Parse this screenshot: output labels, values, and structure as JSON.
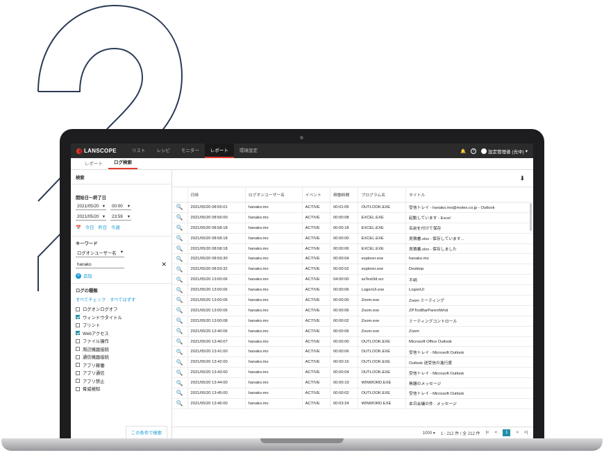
{
  "app": {
    "logo": "LANSCOPE"
  },
  "nav": {
    "items": [
      "リスト",
      "レシピ",
      "モニター",
      "レポート",
      "環境設定"
    ],
    "active_index": 3,
    "user": "設定管理者 (光中)"
  },
  "subtabs": {
    "items": [
      "レポート",
      "ログ検索"
    ],
    "active_index": 1
  },
  "filter": {
    "title": "検索",
    "date_label": "開始日〜終了日",
    "start_date": "2021/05/20",
    "start_time": "00:00",
    "end_date": "2021/05/20",
    "end_time": "23:59",
    "quick": [
      "今日",
      "昨日",
      "今週"
    ],
    "keyword_label": "キーワード",
    "keyword_field": "ログオンユーザー名",
    "keyword_value": "hanako",
    "add_label": "追加",
    "types_label": "ログの種類",
    "check_all": "すべてチェック",
    "uncheck_all": "すべてはずす",
    "types": [
      {
        "label": "ログオンログオフ",
        "checked": false
      },
      {
        "label": "ウィンドウタイトル",
        "checked": true
      },
      {
        "label": "プリント",
        "checked": false
      },
      {
        "label": "Webアクセス",
        "checked": true
      },
      {
        "label": "ファイル操作",
        "checked": false
      },
      {
        "label": "周辺機器接続",
        "checked": false
      },
      {
        "label": "通信機器接続",
        "checked": false
      },
      {
        "label": "アプリ稼働",
        "checked": false
      },
      {
        "label": "アプリ通信",
        "checked": false
      },
      {
        "label": "アプリ禁止",
        "checked": false
      },
      {
        "label": "脅威検知",
        "checked": false
      }
    ],
    "search_button": "この条件で検索"
  },
  "table": {
    "columns": [
      "日時",
      "ログオンユーザー名",
      "イベント",
      "稼働時間",
      "プログラム名",
      "タイトル"
    ],
    "rows": [
      [
        "2021/05/20 08:55:01",
        "hanako.mo",
        "ACTIVE",
        "00:01:05",
        "OUTLOOK.EXE",
        "受信トレイ - hanako.mo@motex.co.jp - Outlook"
      ],
      [
        "2021/05/20 08:56:00",
        "hanako.mo",
        "ACTIVE",
        "00:00:08",
        "EXCEL.EXE",
        "起動しています - Excel"
      ],
      [
        "2021/05/20 08:58:18",
        "hanako.mo",
        "ACTIVE",
        "00:00:18",
        "EXCEL.EXE",
        "名前を付けて保存"
      ],
      [
        "2021/05/20 08:58:18",
        "hanako.mo",
        "ACTIVE",
        "00:00:00",
        "EXCEL.EXE",
        "見積書.xlsx - 保存しています..."
      ],
      [
        "2021/05/20 08:58:18",
        "hanako.mo",
        "ACTIVE",
        "00:00:06",
        "EXCEL.EXE",
        "見積書.xlsx - 保存しました"
      ],
      [
        "2021/05/20 08:59:30",
        "hanako.mo",
        "ACTIVE",
        "00:00:04",
        "explorer.exe",
        "hanako.mo"
      ],
      [
        "2021/05/20 08:59:32",
        "hanako.mo",
        "ACTIVE",
        "00:00:02",
        "explorer.exe",
        "Desktop"
      ],
      [
        "2021/05/20 13:00:06",
        "hanako.mo",
        "ACTIVE",
        "04:00:00",
        "ssText3d.scr",
        "不明"
      ],
      [
        "2021/05/20 13:00:06",
        "hanako.mo",
        "ACTIVE",
        "00:00:06",
        "LogonUI.exe",
        "LogonUI"
      ],
      [
        "2021/05/20 13:00:06",
        "hanako.mo",
        "ACTIVE",
        "00:00:00",
        "Zoom.exe",
        "Zoom ミーティング"
      ],
      [
        "2021/05/20 13:00:06",
        "hanako.mo",
        "ACTIVE",
        "00:00:06",
        "Zoom.exe",
        "ZPToolBarParentWnd"
      ],
      [
        "2021/05/20 13:00:08",
        "hanako.mo",
        "ACTIVE",
        "00:00:02",
        "Zoom.exe",
        "ミーティングコントロール"
      ],
      [
        "2021/05/20 13:40:06",
        "hanako.mo",
        "ACTIVE",
        "00:00:06",
        "Zoom.exe",
        "Zoom"
      ],
      [
        "2021/05/20 13:40:07",
        "hanako.mo",
        "ACTIVE",
        "00:00:00",
        "OUTLOOK.EXE",
        "Microsoft Office Outlook"
      ],
      [
        "2021/05/20 13:41:00",
        "hanako.mo",
        "ACTIVE",
        "00:00:06",
        "OUTLOOK.EXE",
        "受信トレイ - Microsoft Outlook"
      ],
      [
        "2021/05/20 13:42:00",
        "hanako.mo",
        "ACTIVE",
        "00:00:16",
        "OUTLOOK.EXE",
        "Outlook 送受信の進行度"
      ],
      [
        "2021/05/20 13:43:00",
        "hanako.mo",
        "ACTIVE",
        "00:00:04",
        "OUTLOOK.EXE",
        "受信トレイ - Microsoft Outlook"
      ],
      [
        "2021/05/20 13:44:00",
        "hanako.mo",
        "ACTIVE",
        "00:00:19",
        "WINWORD.EXE",
        "無題のメッセージ"
      ],
      [
        "2021/05/20 13:45:00",
        "hanako.mo",
        "ACTIVE",
        "00:00:02",
        "OUTLOOK.EXE",
        "受信トレイ - Microsoft Outlook"
      ],
      [
        "2021/05/20 13:46:00",
        "hanako.mo",
        "ACTIVE",
        "00:03:24",
        "WINWORD.EXE",
        "本日会議の件 - メッセージ"
      ]
    ]
  },
  "pager": {
    "per_page": "1000",
    "summary": "1 - 212 件 / 全 212 件",
    "current": "1"
  },
  "deco": {
    "big_digit": "2"
  }
}
